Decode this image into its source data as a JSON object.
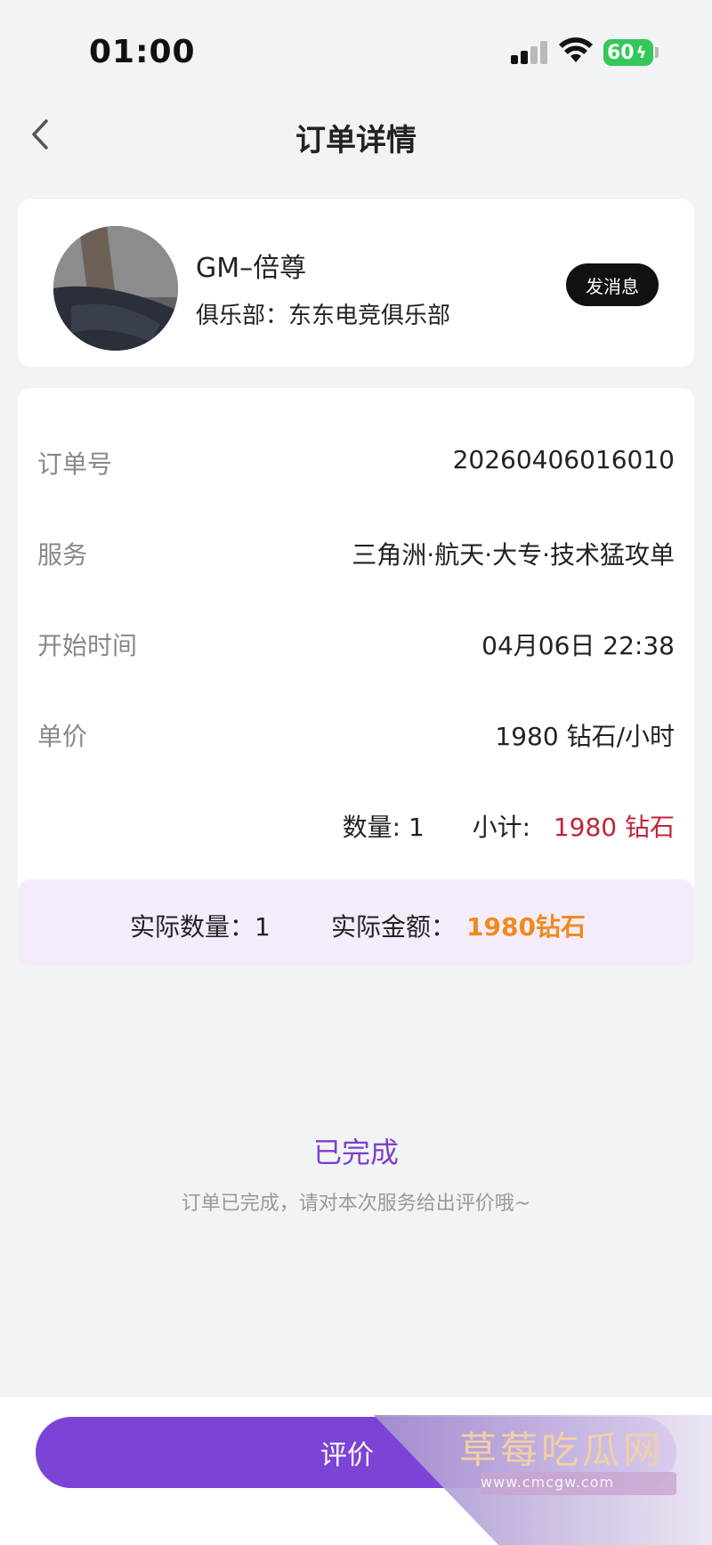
{
  "status_bar": {
    "time": "01:00",
    "battery": "60"
  },
  "nav": {
    "title": "订单详情"
  },
  "profile": {
    "nickname": "GM–倍尊",
    "club": "俱乐部：东东电竞俱乐部",
    "message_button": "发消息"
  },
  "order": {
    "rows": [
      {
        "label": "订单号",
        "value": "20260406016010"
      },
      {
        "label": "服务",
        "value": "三角洲·航天·大专·技术猛攻单"
      },
      {
        "label": "开始时间",
        "value": "04月06日 22:38"
      },
      {
        "label": "单价",
        "value": "1980 钻石/小时"
      }
    ],
    "quantity_text": "数量: 1",
    "subtotal_label": "小计:",
    "subtotal_value": "1980 钻石",
    "actual_quantity": "实际数量：1",
    "actual_amount_label": "实际金额：",
    "actual_amount_value": "1980钻石"
  },
  "completion": {
    "title": "已完成",
    "subtitle": "订单已完成，请对本次服务给出评价哦~"
  },
  "bottom": {
    "review_button": "评价"
  },
  "watermark": {
    "text": "草莓吃瓜网",
    "url": "www.cmcgw.com"
  },
  "colors": {
    "accent": "#7b44d6",
    "price_red": "#c0233a",
    "amount_orange": "#f08a1c"
  }
}
